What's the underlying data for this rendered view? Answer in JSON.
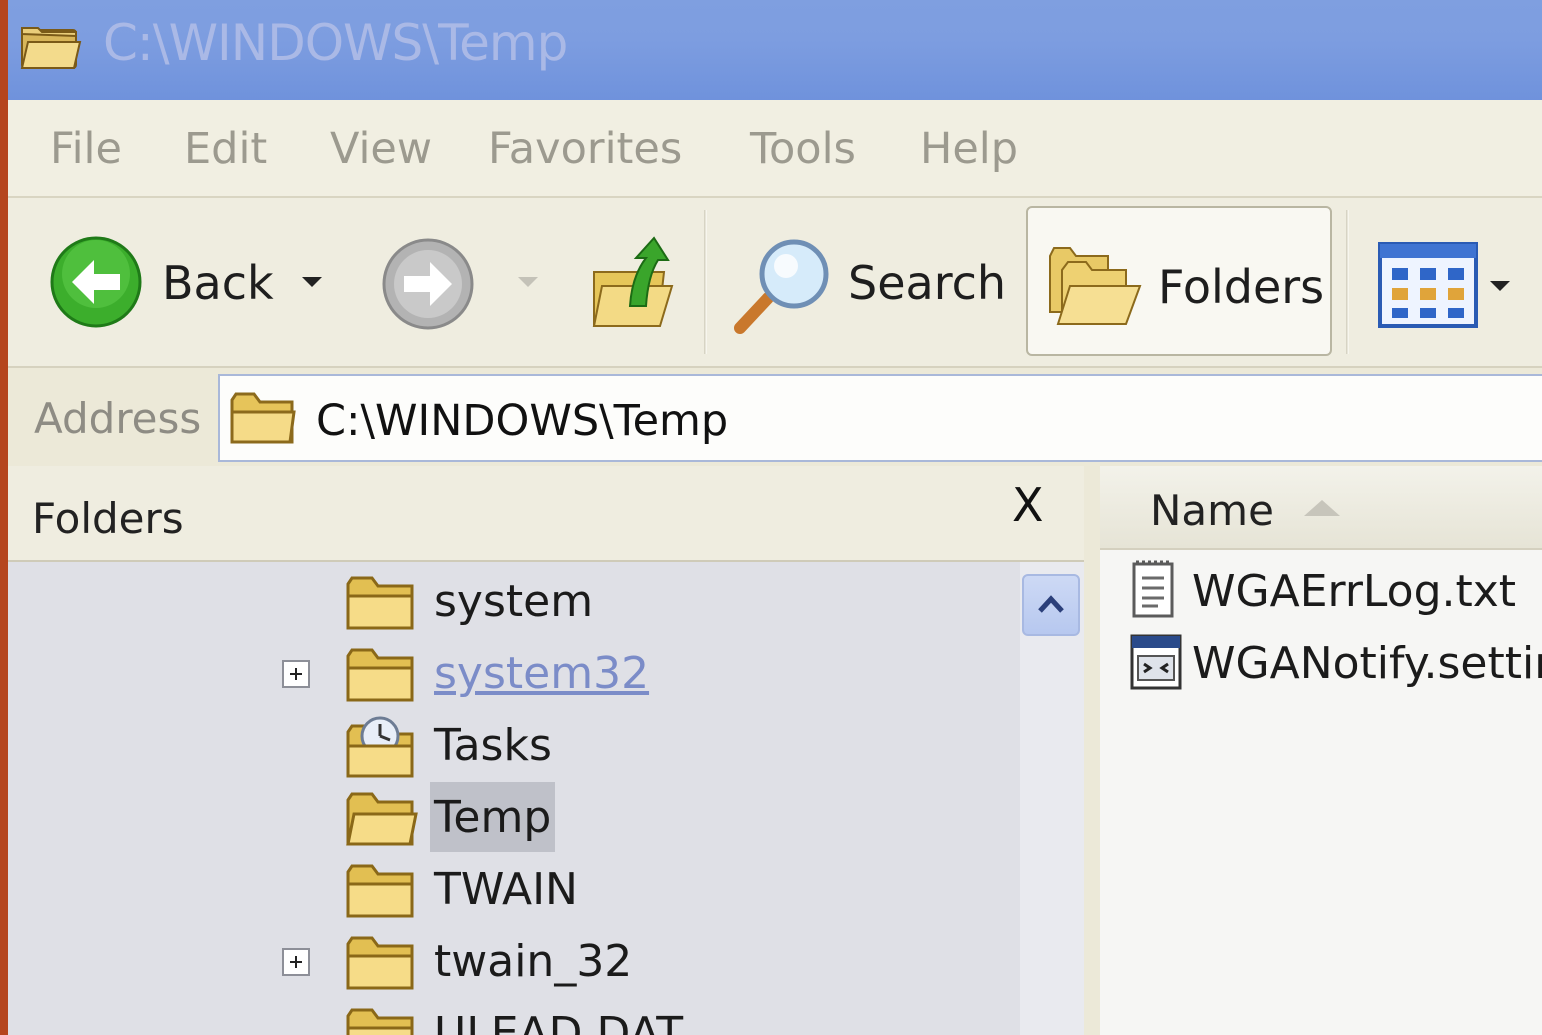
{
  "window": {
    "title": "C:\\WINDOWS\\Temp"
  },
  "menubar": {
    "items": [
      "File",
      "Edit",
      "View",
      "Favorites",
      "Tools",
      "Help"
    ]
  },
  "toolbar": {
    "back_label": "Back",
    "search_label": "Search",
    "folders_label": "Folders"
  },
  "address": {
    "label": "Address",
    "path": "C:\\WINDOWS\\Temp"
  },
  "folders_pane": {
    "title": "Folders",
    "close_glyph": "X",
    "tree": [
      {
        "label": "system",
        "expandable": false,
        "state": "normal"
      },
      {
        "label": "system32",
        "expandable": true,
        "state": "hover"
      },
      {
        "label": "Tasks",
        "expandable": false,
        "state": "normal"
      },
      {
        "label": "Temp",
        "expandable": false,
        "state": "selected"
      },
      {
        "label": "TWAIN",
        "expandable": false,
        "state": "normal"
      },
      {
        "label": "twain_32",
        "expandable": true,
        "state": "normal"
      },
      {
        "label": "ULEAD.DAT",
        "expandable": false,
        "state": "normal"
      }
    ]
  },
  "files_pane": {
    "column_name": "Name",
    "files": [
      {
        "name": "WGAErrLog.txt",
        "icon": "text-file-icon"
      },
      {
        "name": "WGANotify.settings",
        "icon": "settings-file-icon"
      }
    ]
  }
}
